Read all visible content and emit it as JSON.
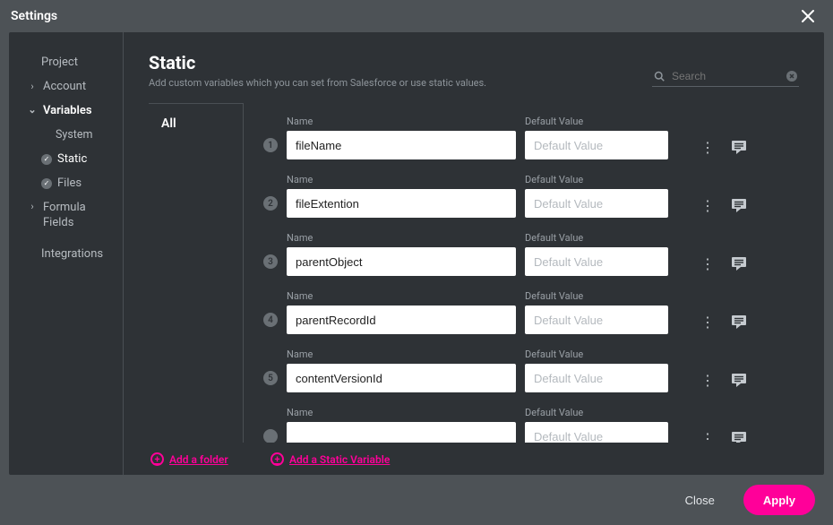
{
  "window": {
    "title": "Settings"
  },
  "sidebar": {
    "project": "Project",
    "account": "Account",
    "variables": "Variables",
    "system": "System",
    "static": "Static",
    "files": "Files",
    "formula_fields": "Formula Fields",
    "integrations": "Integrations"
  },
  "main": {
    "title": "Static",
    "subtitle": "Add custom variables which you can set from Salesforce or use static values."
  },
  "search": {
    "placeholder": "Search"
  },
  "folders": {
    "all": "All"
  },
  "labels": {
    "name": "Name",
    "default": "Default Value",
    "default_ph": "Default Value"
  },
  "rows": [
    {
      "num": "1",
      "name": "fileName",
      "default": ""
    },
    {
      "num": "2",
      "name": "fileExtention",
      "default": ""
    },
    {
      "num": "3",
      "name": "parentObject",
      "default": ""
    },
    {
      "num": "4",
      "name": "parentRecordId",
      "default": ""
    },
    {
      "num": "5",
      "name": "contentVersionId",
      "default": ""
    },
    {
      "num": "",
      "name": "",
      "default": ""
    }
  ],
  "actions": {
    "add_folder": "Add a folder",
    "add_variable": "Add a Static Variable"
  },
  "footer": {
    "close": "Close",
    "apply": "Apply"
  }
}
